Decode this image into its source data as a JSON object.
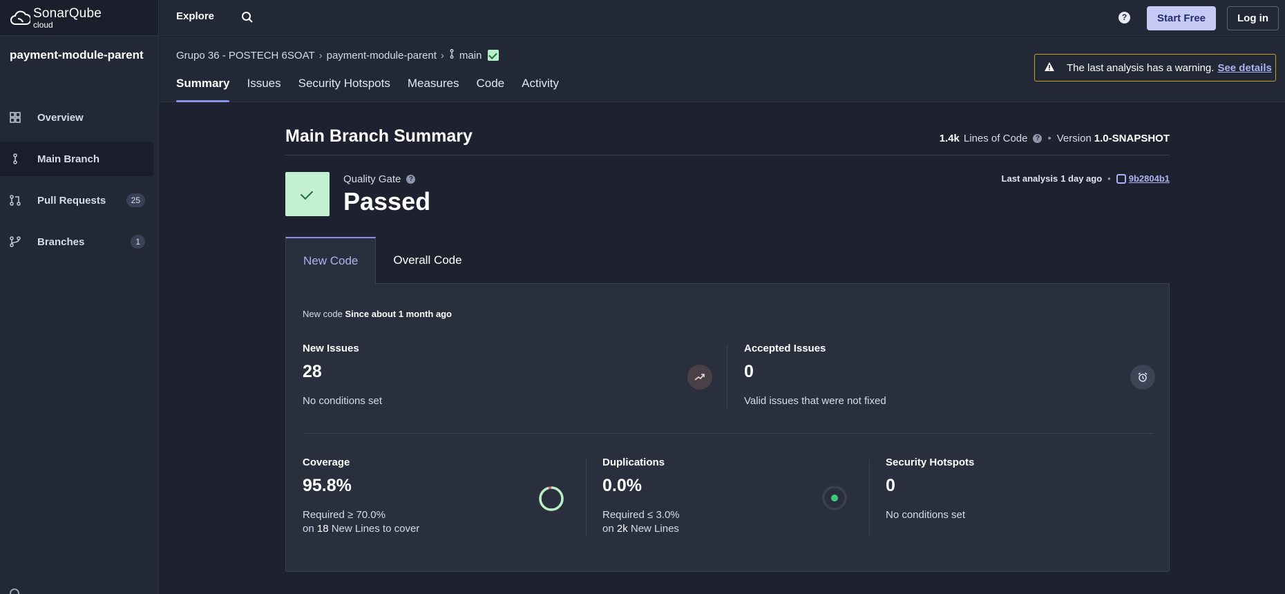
{
  "brand": {
    "name": "SonarQube",
    "sub": "cloud"
  },
  "sidebar": {
    "project": "payment-module-parent",
    "items": [
      {
        "label": "Overview",
        "icon": "grid-icon"
      },
      {
        "label": "Main Branch",
        "icon": "branch-icon",
        "active": true
      },
      {
        "label": "Pull Requests",
        "icon": "pull-request-icon",
        "badge": "25"
      },
      {
        "label": "Branches",
        "icon": "branches-icon",
        "badge": "1"
      }
    ]
  },
  "topbar": {
    "explore": "Explore",
    "help": "?",
    "start_free": "Start Free",
    "login": "Log in"
  },
  "breadcrumb": {
    "org": "Grupo 36 - POSTECH 6SOAT",
    "project": "payment-module-parent",
    "branch": "main"
  },
  "tabs": [
    "Summary",
    "Issues",
    "Security Hotspots",
    "Measures",
    "Code",
    "Activity"
  ],
  "warning": {
    "text": "The last analysis has a warning.",
    "link": "See details"
  },
  "summary": {
    "title": "Main Branch Summary",
    "loc_value": "1.4k",
    "loc_label": "Lines of Code",
    "version_label": "Version",
    "version_value": "1.0-SNAPSHOT",
    "quality_gate_label": "Quality Gate",
    "quality_gate_status": "Passed",
    "last_analysis_label": "Last analysis",
    "last_analysis_value": "1 day ago",
    "commit_hash": "9b2804b1"
  },
  "code_tabs": [
    "New Code",
    "Overall Code"
  ],
  "panel": {
    "new_code_label": "New code",
    "new_code_since": "Since about 1 month ago",
    "new_issues": {
      "label": "New Issues",
      "value": "28",
      "sub": "No conditions set"
    },
    "accepted_issues": {
      "label": "Accepted Issues",
      "value": "0",
      "sub": "Valid issues that were not fixed"
    },
    "coverage": {
      "label": "Coverage",
      "value": "95.8%",
      "required": "Required ≥ 70.0%",
      "on": "on",
      "lines": "18",
      "lines_label": "New Lines to cover",
      "fraction": 0.958
    },
    "duplications": {
      "label": "Duplications",
      "value": "0.0%",
      "required": "Required ≤ 3.0%",
      "on": "on",
      "lines": "2k",
      "lines_label": "New Lines"
    },
    "hotspots": {
      "label": "Security Hotspots",
      "value": "0",
      "sub": "No conditions set"
    }
  },
  "colors": {
    "accent": "#8a93e6",
    "passed": "#c4f0d2",
    "warning_border": "#c9a227",
    "coverage_ring": "#b6f0c7"
  }
}
